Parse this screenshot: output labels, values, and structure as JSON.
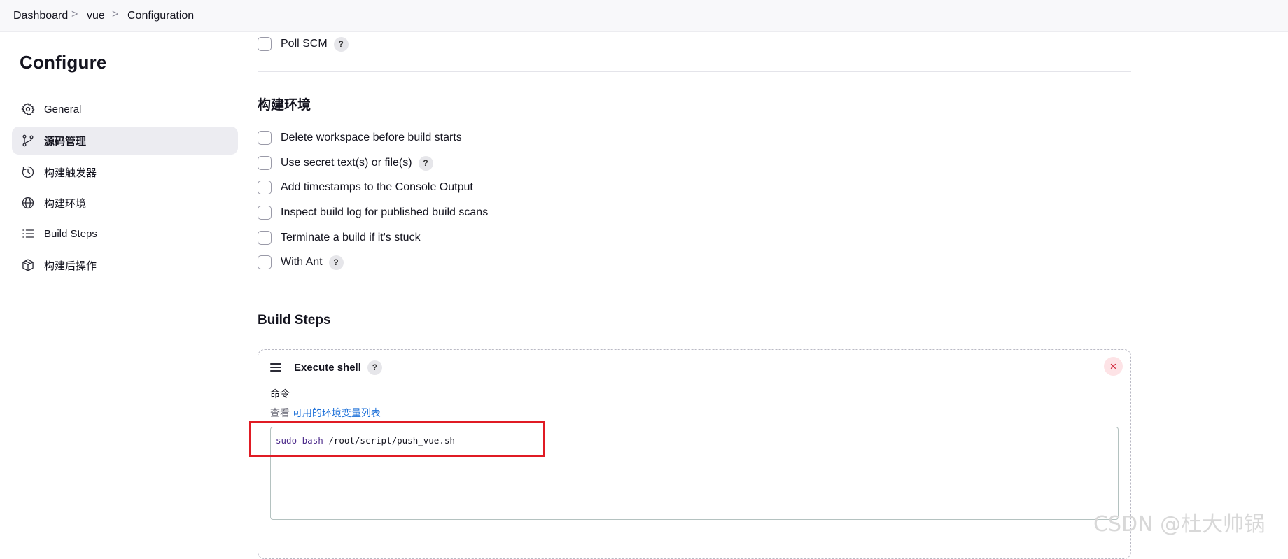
{
  "breadcrumb": {
    "items": [
      "Dashboard",
      "vue",
      "Configuration"
    ],
    "separator": ">"
  },
  "sidebar": {
    "title": "Configure",
    "items": [
      {
        "label": "General",
        "icon": "gear-icon"
      },
      {
        "label": "源码管理",
        "icon": "branch-icon",
        "active": true
      },
      {
        "label": "构建触发器",
        "icon": "clock-icon"
      },
      {
        "label": "构建环境",
        "icon": "globe-icon"
      },
      {
        "label": "Build Steps",
        "icon": "list-icon"
      },
      {
        "label": "构建后操作",
        "icon": "package-icon"
      }
    ]
  },
  "triggers": {
    "poll_scm": "Poll SCM"
  },
  "build_env": {
    "title": "构建环境",
    "options": [
      "Delete workspace before build starts",
      "Use secret text(s) or file(s)",
      "Add timestamps to the Console Output",
      "Inspect build log for published build scans",
      "Terminate a build if it's stuck",
      "With Ant"
    ]
  },
  "build_steps": {
    "title": "Build Steps",
    "step": {
      "title": "Execute shell",
      "help": "?",
      "close": "×",
      "field_label": "命令",
      "env_prefix": "查看",
      "env_link": "可用的环境变量列表",
      "command_keyword1": "sudo",
      "command_keyword2": "bash",
      "command_rest": "/root/script/push_vue.sh"
    }
  },
  "help_label": "?",
  "watermark": "CSDN @杜大帅锅",
  "colors": {
    "accent_link": "#1b6fd8",
    "highlight_box": "#e01b24",
    "active_bg": "#ececf1"
  }
}
